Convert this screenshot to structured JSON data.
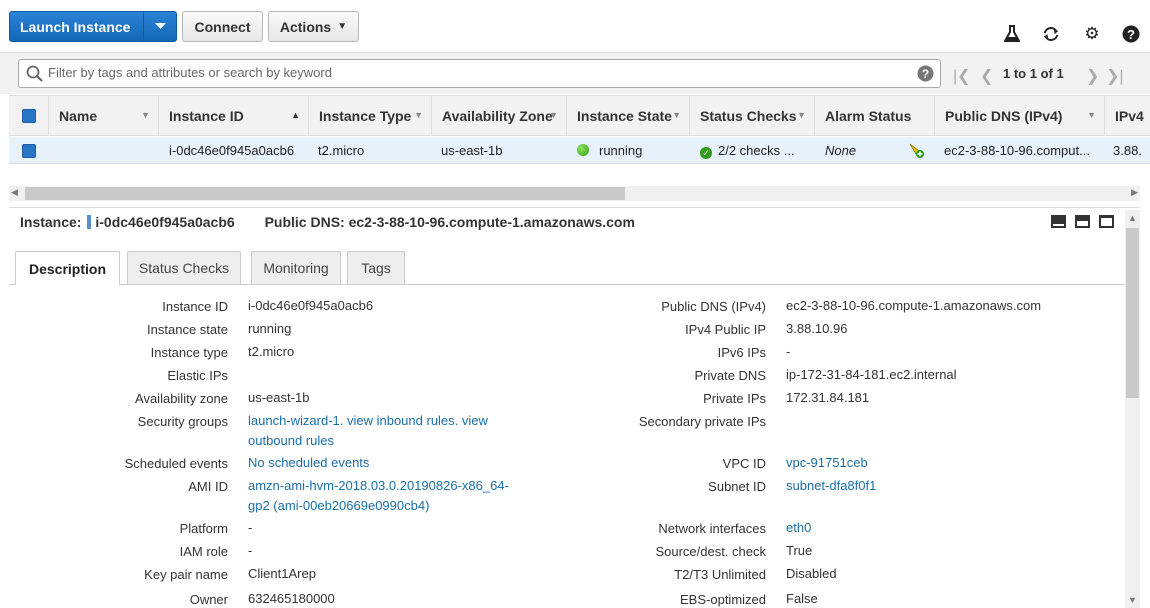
{
  "toolbar": {
    "launch_label": "Launch Instance",
    "connect_label": "Connect",
    "actions_label": "Actions",
    "icons": [
      "flask-icon",
      "refresh-icon",
      "gear-icon",
      "help-icon"
    ]
  },
  "search": {
    "placeholder": "Filter by tags and attributes or search by keyword",
    "pager_text": "1 to 1 of 1"
  },
  "table": {
    "columns": [
      "Name",
      "Instance ID",
      "Instance Type",
      "Availability Zone",
      "Instance State",
      "Status Checks",
      "Alarm Status",
      "Public DNS (IPv4)",
      "IPv4"
    ],
    "row": {
      "name": "",
      "instance_id": "i-0dc46e0f945a0acb6",
      "instance_type": "t2.micro",
      "availability_zone": "us-east-1b",
      "instance_state": "running",
      "status_checks": "2/2 checks ...",
      "alarm_status": "None",
      "public_dns": "ec2-3-88-10-96.comput...",
      "ipv4": "3.88."
    }
  },
  "details": {
    "instance_label": "Instance:",
    "instance_id": "i-0dc46e0f945a0acb6",
    "dns_label": "Public DNS:",
    "dns_value": "ec2-3-88-10-96.compute-1.amazonaws.com",
    "tabs": [
      "Description",
      "Status Checks",
      "Monitoring",
      "Tags"
    ],
    "left": [
      {
        "label": "Instance ID",
        "value": "i-0dc46e0f945a0acb6"
      },
      {
        "label": "Instance state",
        "value": "running"
      },
      {
        "label": "Instance type",
        "value": "t2.micro"
      },
      {
        "label": "Elastic IPs",
        "value": ""
      },
      {
        "label": "Availability zone",
        "value": "us-east-1b"
      },
      {
        "label": "Security groups",
        "value": "launch-wizard-1. view inbound rules. view outbound rules"
      },
      {
        "label": "Scheduled events",
        "value": "No scheduled events"
      },
      {
        "label": "AMI ID",
        "value": "amzn-ami-hvm-2018.03.0.20190826-x86_64-gp2 (ami-00eb20669e0990cb4)"
      },
      {
        "label": "Platform",
        "value": "-"
      },
      {
        "label": "IAM role",
        "value": "-"
      },
      {
        "label": "Key pair name",
        "value": "Client1Arep"
      },
      {
        "label": "Owner",
        "value": "632465180000"
      }
    ],
    "right": [
      {
        "label": "Public DNS (IPv4)",
        "value": "ec2-3-88-10-96.compute-1.amazonaws.com"
      },
      {
        "label": "IPv4 Public IP",
        "value": "3.88.10.96"
      },
      {
        "label": "IPv6 IPs",
        "value": "-"
      },
      {
        "label": "Private DNS",
        "value": "ip-172-31-84-181.ec2.internal"
      },
      {
        "label": "Private IPs",
        "value": "172.31.84.181"
      },
      {
        "label": "Secondary private IPs",
        "value": ""
      },
      {
        "label": "VPC ID",
        "value": "vpc-91751ceb"
      },
      {
        "label": "Subnet ID",
        "value": "subnet-dfa8f0f1"
      },
      {
        "label": "Network interfaces",
        "value": "eth0"
      },
      {
        "label": "Source/dest. check",
        "value": "True"
      },
      {
        "label": "T2/T3 Unlimited",
        "value": "Disabled"
      },
      {
        "label": "EBS-optimized",
        "value": "False"
      }
    ]
  }
}
